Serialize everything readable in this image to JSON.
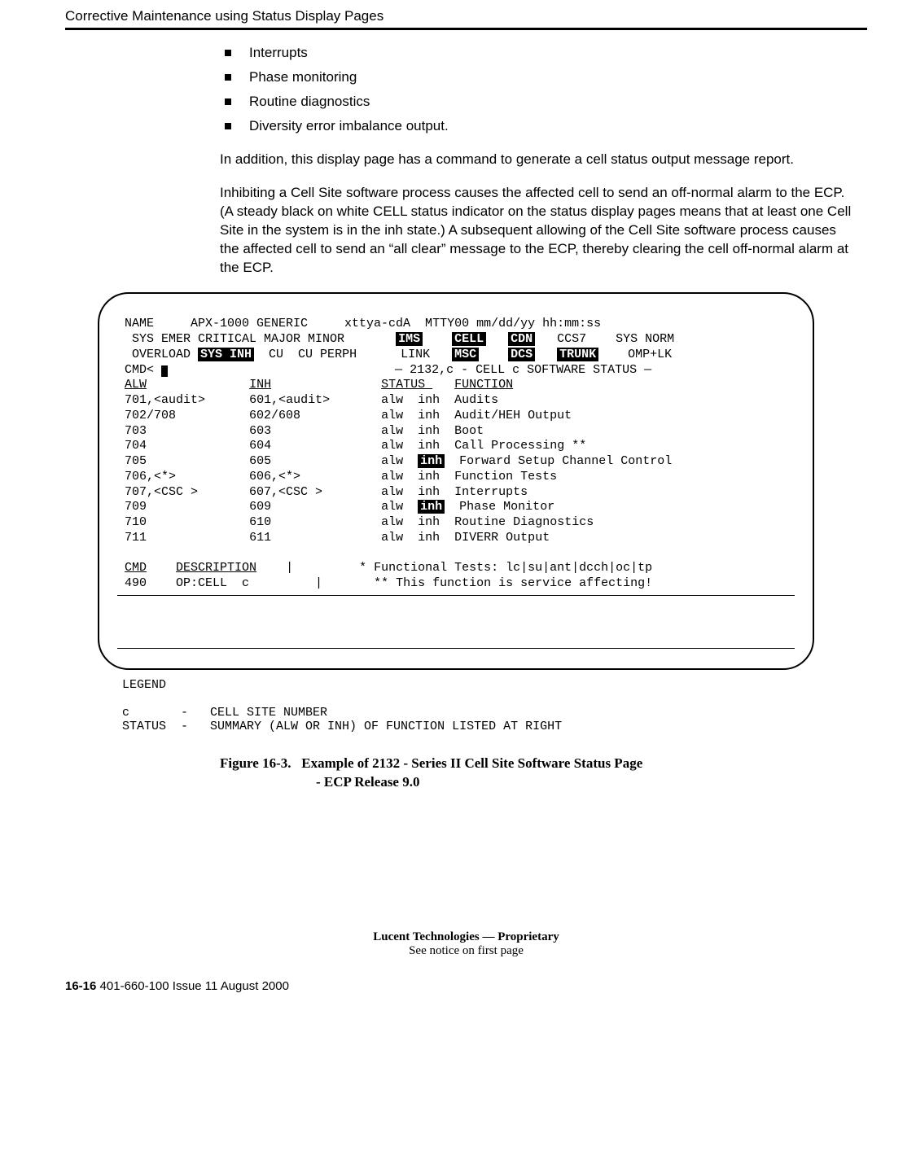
{
  "header": {
    "title": "Corrective Maintenance using Status Display Pages"
  },
  "bullets": [
    "Interrupts",
    "Phase monitoring",
    "Routine diagnostics",
    "Diversity error imbalance output."
  ],
  "para1": "In addition, this display page has a command to generate a cell status output message report.",
  "para2_a": "Inhibiting a Cell Site software process causes the affected cell to send an off-normal alarm to the ECP. (A steady black on white ",
  "para2_cell": "CELL",
  "para2_b": " status indicator on the status display pages means that at least one Cell Site in the system is in the inh state.) A subsequent allowing of the Cell Site software process causes the affected cell to send an “all clear” message to the ECP, thereby clearing the cell off-normal alarm at the ECP.",
  "terminal": {
    "line1": " NAME     APX-1000 GENERIC     xttya-cdA  MTTY00 mm/dd/yy hh:mm:ss",
    "line2_a": "  SYS EMER CRITICAL MAJOR MINOR       ",
    "ims": "IMS",
    "line2_b": "    ",
    "cell": "CELL",
    "line2_c": "   ",
    "cdn": "CDN",
    "line2_d": "   CCS7    SYS NORM",
    "line3_a": "  OVERLOAD ",
    "sysinh": "SYS INH",
    "line3_b": "  CU  CU PERPH      LINK   ",
    "msc": "MSC",
    "line3_c": "    ",
    "dcs": "DCS",
    "line3_d": "   ",
    "trunk": "TRUNK",
    "line3_e": "    OMP+LK",
    "cmd_prompt": " CMD< ",
    "statusline": "                               — 2132,c - CELL c SOFTWARE STATUS —",
    "col_alw": "ALW",
    "col_inh": "INH",
    "col_status": "STATUS ",
    "col_function": "FUNCTION",
    "rows": [
      {
        "alw": "701,<audit>",
        "inh": "601,<audit>",
        "status_a": "alw",
        "status_b": "inh",
        "inv_b": false,
        "func": "Audits"
      },
      {
        "alw": "702/708",
        "inh": "602/608",
        "status_a": "alw",
        "status_b": "inh",
        "inv_b": false,
        "func": "Audit/HEH Output"
      },
      {
        "alw": "703",
        "inh": "603",
        "status_a": "alw",
        "status_b": "inh",
        "inv_b": false,
        "func": "Boot"
      },
      {
        "alw": "704",
        "inh": "604",
        "status_a": "alw",
        "status_b": "inh",
        "inv_b": false,
        "func": "Call Processing **"
      },
      {
        "alw": "705",
        "inh": "605",
        "status_a": "alw",
        "status_b": "inh",
        "inv_b": true,
        "func": "Forward Setup Channel Control"
      },
      {
        "alw": "706,<*>",
        "inh": "606,<*>",
        "status_a": "alw",
        "status_b": "inh",
        "inv_b": false,
        "func": "Function Tests"
      },
      {
        "alw": "707,<CSC >",
        "inh": "607,<CSC >",
        "status_a": "alw",
        "status_b": "inh",
        "inv_b": false,
        "func": "Interrupts"
      },
      {
        "alw": "709",
        "inh": "609",
        "status_a": "alw",
        "status_b": "inh",
        "inv_b": true,
        "func": "Phase Monitor"
      },
      {
        "alw": "710",
        "inh": "610",
        "status_a": "alw",
        "status_b": "inh",
        "inv_b": false,
        "func": "Routine Diagnostics"
      },
      {
        "alw": "711",
        "inh": "611",
        "status_a": "alw",
        "status_b": "inh",
        "inv_b": false,
        "func": "DIVERR Output"
      }
    ],
    "cmd_h": "CMD",
    "desc_h": "DESCRIPTION",
    "note1": " * Functional Tests: lc|su|ant|dcch|oc|tp",
    "cmdrow": " 490    OP:CELL  c",
    "note2": "** This function is service affecting!"
  },
  "legend": {
    "title": "LEGEND",
    "l1": "c       -   CELL SITE NUMBER",
    "l2": "STATUS  -   SUMMARY (ALW OR INH) OF FUNCTION LISTED AT RIGHT"
  },
  "figure": {
    "label": "Figure 16-3.",
    "text_a": "Example of 2132 - Series II Cell Site Software Status Page",
    "text_b": "- ECP Release 9.0"
  },
  "footer": {
    "line1": "Lucent Technologies — Proprietary",
    "line2": "See notice on first page"
  },
  "pagefooter": {
    "pageno": "16-16",
    "rest": "   401-660-100 Issue 11    August 2000"
  }
}
